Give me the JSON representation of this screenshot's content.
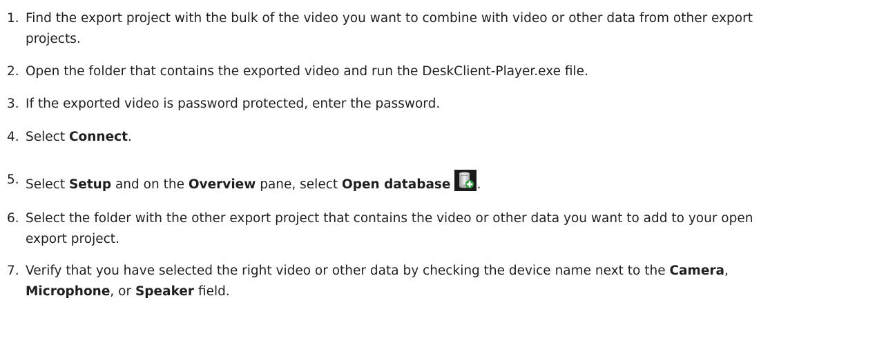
{
  "steps": [
    {
      "number": "1.",
      "text_line1": "Find the export project with the bulk of the video you want to combine with video or other data from other export",
      "text_line2": "projects."
    },
    {
      "number": "2.",
      "text": "Open the folder that contains the exported video and run the DeskClient-Player.exe file."
    },
    {
      "number": "3.",
      "text": "If the exported video is password protected, enter the password."
    },
    {
      "number": "4.",
      "prefix": "Select ",
      "bold": "Connect",
      "suffix": "."
    },
    {
      "number": "5.",
      "p1": "Select ",
      "b1": "Setup",
      "p2": " and on the ",
      "b2": "Overview",
      "p3": " pane, select ",
      "b3": "Open database",
      "p4": ".",
      "icon": "open-database-icon"
    },
    {
      "number": "6.",
      "text_line1": "Select the folder with the other export project that contains the video or other data you want to add to your open",
      "text_line2": "export project."
    },
    {
      "number": "7.",
      "l1_text": "Verify that you have selected the right video or other data by checking the device name next to the ",
      "l1_bold": "Camera",
      "l1_suffix": ",",
      "l2_bold1": "Microphone",
      "l2_text1": ", or ",
      "l2_bold2": "Speaker",
      "l2_text2": " field."
    }
  ]
}
